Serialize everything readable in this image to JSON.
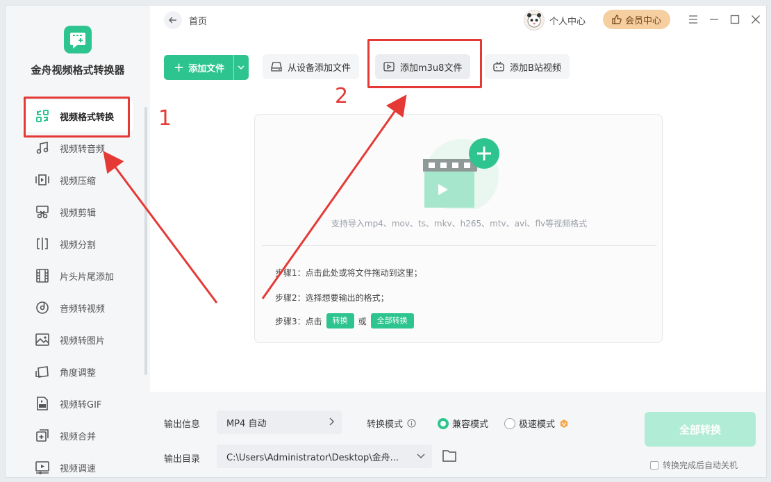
{
  "app": {
    "name": "金舟视频格式转换器",
    "brand_color": "#2ec48f"
  },
  "sidebar": {
    "items": [
      {
        "label": "视频格式转换",
        "icon": "video-convert-icon",
        "active": true
      },
      {
        "label": "视频转音频",
        "icon": "music-note-icon"
      },
      {
        "label": "视频压缩",
        "icon": "compress-icon"
      },
      {
        "label": "视频剪辑",
        "icon": "scissors-icon"
      },
      {
        "label": "视频分割",
        "icon": "split-icon"
      },
      {
        "label": "片头片尾添加",
        "icon": "film-strip-icon"
      },
      {
        "label": "音频转视频",
        "icon": "audio-disc-icon"
      },
      {
        "label": "视频转图片",
        "icon": "image-icon"
      },
      {
        "label": "角度调整",
        "icon": "rotate-icon"
      },
      {
        "label": "视频转GIF",
        "icon": "gif-file-icon"
      },
      {
        "label": "视频合并",
        "icon": "merge-icon"
      },
      {
        "label": "视频调速",
        "icon": "speed-icon"
      }
    ]
  },
  "header": {
    "title": "首页",
    "user_center": "个人中心",
    "vip_center": "会员中心"
  },
  "toolbar": {
    "add_file": "添加文件",
    "add_from_device": "从设备添加文件",
    "add_m3u8": "添加m3u8文件",
    "add_bilibili": "添加B站视频"
  },
  "dropzone": {
    "hint": "支持导入mp4、mov、ts、mkv、h265、mtv、avi、flv等视频格式",
    "step1": "步骤1：点击此处或将文件拖动到这里；",
    "step2": "步骤2：选择想要输出的格式；",
    "step3_prefix": "步骤3：点击",
    "step3_convert": "转换",
    "step3_or": "或",
    "step3_convert_all": "全部转换"
  },
  "output": {
    "info_label": "输出信息",
    "format_value": "MP4 自动",
    "dir_label": "输出目录",
    "dir_value": "C:\\Users\\Administrator\\Desktop\\金舟...",
    "mode_label": "转换模式",
    "mode_compat": "兼容模式",
    "mode_fast": "极速模式",
    "selected_mode": "兼容模式",
    "convert_all": "全部转换",
    "auto_shutdown": "转换完成后自动关机",
    "auto_shutdown_checked": false
  },
  "annotations": {
    "num1": "1",
    "num2": "2",
    "color": "#e53935"
  }
}
